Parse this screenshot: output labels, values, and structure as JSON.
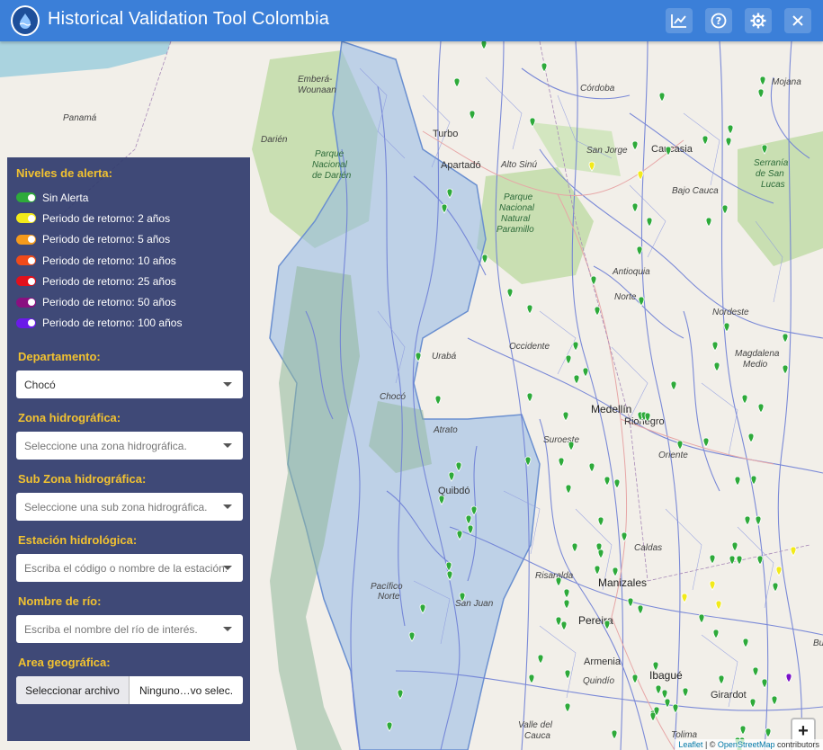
{
  "header": {
    "title": "Historical Validation Tool Colombia",
    "buttons": [
      {
        "name": "chart-button",
        "icon": "chart-line-icon"
      },
      {
        "name": "help-button",
        "icon": "question-circle-icon"
      },
      {
        "name": "settings-button",
        "icon": "gear-icon"
      },
      {
        "name": "close-button",
        "icon": "close-icon"
      }
    ]
  },
  "legend": {
    "title": "Niveles de alerta:",
    "items": [
      {
        "label": "Sin Alerta",
        "color": "#2eaa3a"
      },
      {
        "label": "Periodo de retorno: 2 años",
        "color": "#f2ea1a"
      },
      {
        "label": "Periodo de retorno: 5 años",
        "color": "#f59a1c"
      },
      {
        "label": "Periodo de retorno: 10 años",
        "color": "#f04a1a"
      },
      {
        "label": "Periodo de retorno: 25 años",
        "color": "#e0101c"
      },
      {
        "label": "Periodo de retorno: 50 años",
        "color": "#8a1080"
      },
      {
        "label": "Periodo de retorno: 100 años",
        "color": "#6a1ae8"
      }
    ]
  },
  "filters": {
    "departamento": {
      "label": "Departamento:",
      "value": "Chocó"
    },
    "zona": {
      "label": "Zona hidrográfica:",
      "placeholder": "Seleccione una zona hidrográfica."
    },
    "subzona": {
      "label": "Sub Zona hidrográfica:",
      "placeholder": "Seleccione una sub zona hidrográfica."
    },
    "estacion": {
      "label": "Estación hidrológica:",
      "placeholder": "Escriba el código o nombre de la estación."
    },
    "rio": {
      "label": "Nombre de río:",
      "placeholder": "Escriba el nombre del río de interés."
    },
    "area": {
      "label": "Area geográfica:",
      "button": "Seleccionar archivo",
      "filename": "Ninguno…vo selec."
    }
  },
  "map": {
    "labels": [
      {
        "text": "Emberá-",
        "kind": "region"
      },
      {
        "text": "Wounaan",
        "kind": "region"
      },
      {
        "text": "Panamá",
        "kind": "region"
      },
      {
        "text": "Darién",
        "kind": "region"
      },
      {
        "text": "Parque",
        "kind": "park"
      },
      {
        "text": "Nacional",
        "kind": "park"
      },
      {
        "text": "de Darién",
        "kind": "park"
      },
      {
        "text": "Turbo",
        "kind": "city"
      },
      {
        "text": "Apartadó",
        "kind": "city"
      },
      {
        "text": "Alto Sinú",
        "kind": "region"
      },
      {
        "text": "Córdoba",
        "kind": "region"
      },
      {
        "text": "San Jorge",
        "kind": "region"
      },
      {
        "text": "Caucasia",
        "kind": "city"
      },
      {
        "text": "Mojana",
        "kind": "region"
      },
      {
        "text": "Parque",
        "kind": "park"
      },
      {
        "text": "Nacional",
        "kind": "park"
      },
      {
        "text": "Natural",
        "kind": "park"
      },
      {
        "text": "Paramillo",
        "kind": "park"
      },
      {
        "text": "Bajo Cauca",
        "kind": "region"
      },
      {
        "text": "Serranía",
        "kind": "park"
      },
      {
        "text": "de San",
        "kind": "park"
      },
      {
        "text": "Lucas",
        "kind": "park"
      },
      {
        "text": "Antioquia",
        "kind": "region"
      },
      {
        "text": "Norte",
        "kind": "region"
      },
      {
        "text": "Nordeste",
        "kind": "region"
      },
      {
        "text": "Occidente",
        "kind": "region"
      },
      {
        "text": "Urabá",
        "kind": "region"
      },
      {
        "text": "Magdalena",
        "kind": "region"
      },
      {
        "text": "Medio",
        "kind": "region"
      },
      {
        "text": "Chocó",
        "kind": "region"
      },
      {
        "text": "Medellín",
        "kind": "city-big"
      },
      {
        "text": "Rionegro",
        "kind": "city"
      },
      {
        "text": "Atrato",
        "kind": "region"
      },
      {
        "text": "Suroeste",
        "kind": "region"
      },
      {
        "text": "Oriente",
        "kind": "region"
      },
      {
        "text": "Quibdó",
        "kind": "city"
      },
      {
        "text": "Caldas",
        "kind": "region"
      },
      {
        "text": "Risaralda",
        "kind": "region"
      },
      {
        "text": "Manizales",
        "kind": "city-big"
      },
      {
        "text": "Pacífico",
        "kind": "region"
      },
      {
        "text": "Norte",
        "kind": "region"
      },
      {
        "text": "San Juan",
        "kind": "region"
      },
      {
        "text": "Pereira",
        "kind": "city-big"
      },
      {
        "text": "Armenia",
        "kind": "city"
      },
      {
        "text": "Quindío",
        "kind": "region"
      },
      {
        "text": "Ibagué",
        "kind": "city-big"
      },
      {
        "text": "Girardot",
        "kind": "city"
      },
      {
        "text": "Valle del",
        "kind": "region"
      },
      {
        "text": "Cauca",
        "kind": "region"
      },
      {
        "text": "Tolima",
        "kind": "region"
      },
      {
        "text": "Bu",
        "kind": "region"
      }
    ]
  },
  "zoom": {
    "in": "+",
    "out": "−"
  },
  "attribution": {
    "leaflet": "Leaflet",
    "sep": " | © ",
    "osm": "OpenStreetMap",
    "rest": " contributors"
  }
}
